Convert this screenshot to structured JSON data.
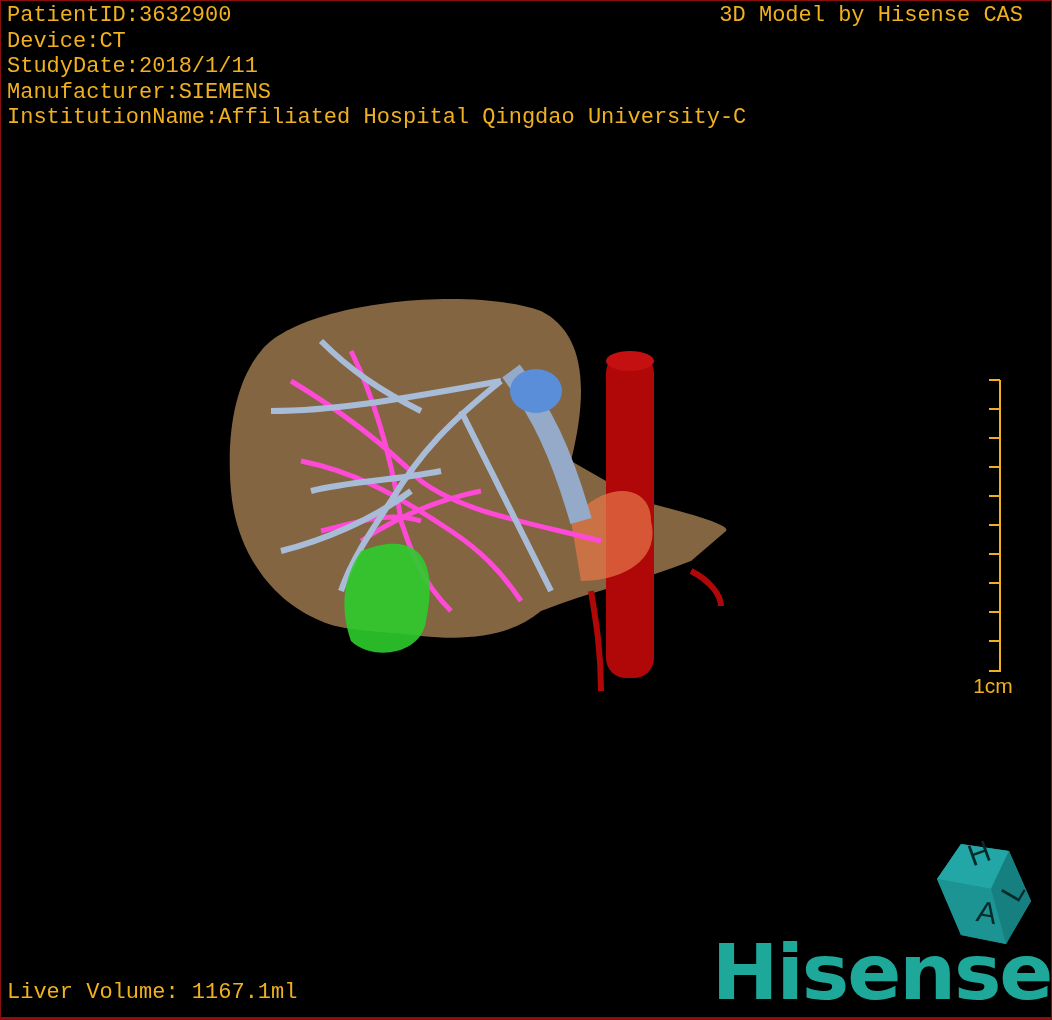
{
  "info_lines": [
    "PatientID:3632900",
    "Device:CT",
    "StudyDate:2018/1/11",
    "Manufacturer:SIEMENS",
    "InstitutionName:Affiliated Hospital Qingdao University-C"
  ],
  "title": "3D Model by Hisense CAS",
  "scale_bar": {
    "label": "1cm"
  },
  "volume": "Liver Volume: 1167.1ml",
  "orientation_cube": [
    "H",
    "A",
    "L"
  ],
  "logo": "Hisense"
}
